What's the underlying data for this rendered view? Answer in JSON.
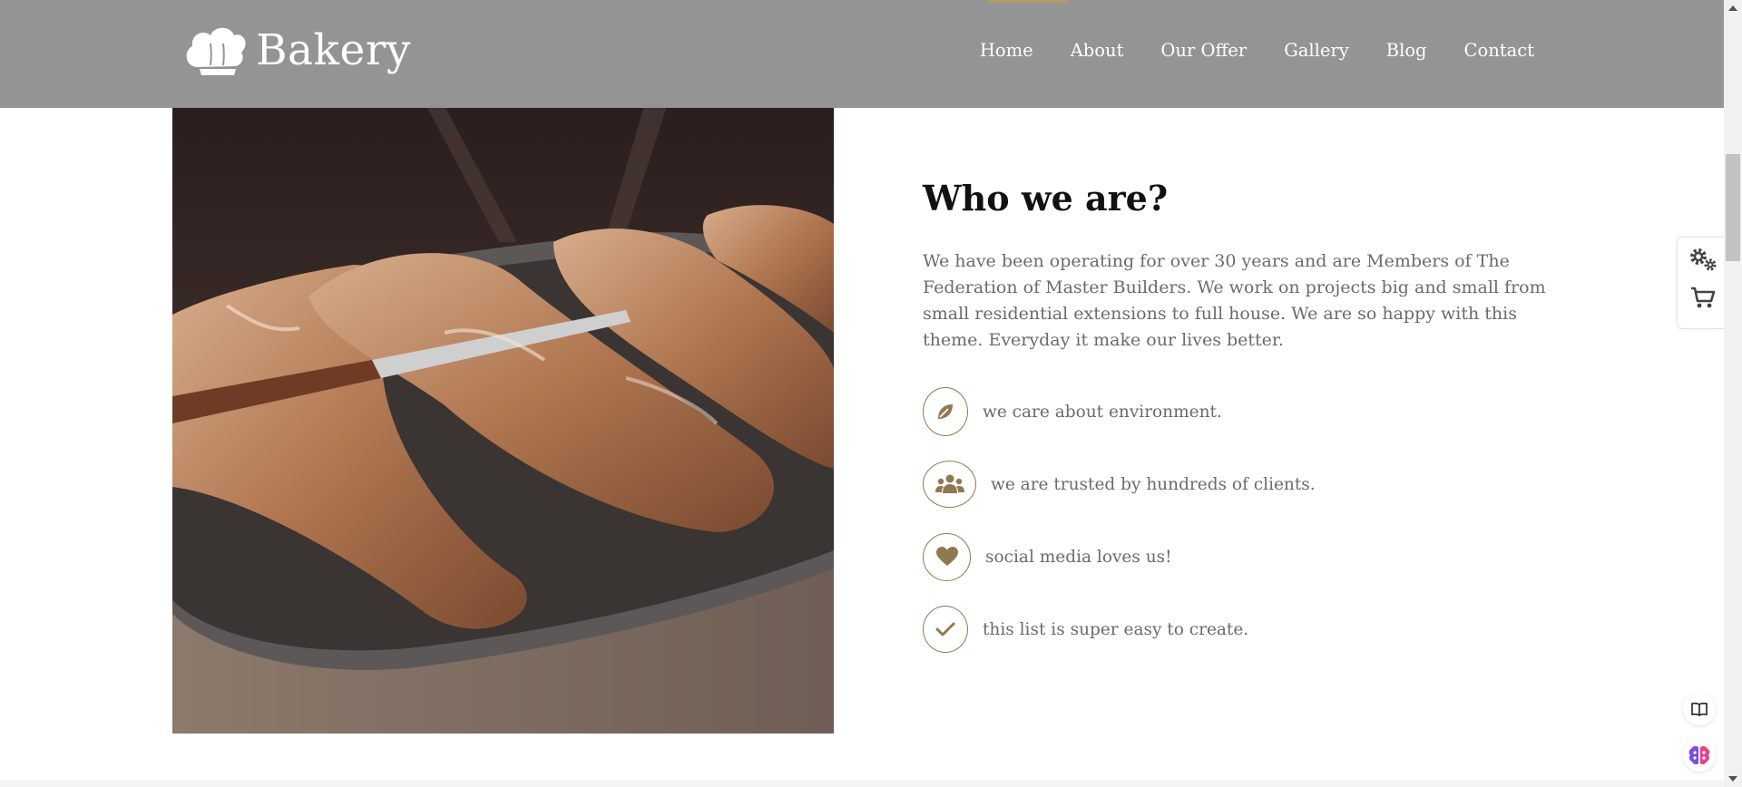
{
  "header": {
    "brand": "Bakery",
    "nav": [
      "Home",
      "About",
      "Our Offer",
      "Gallery",
      "Blog",
      "Contact"
    ]
  },
  "about": {
    "title": "Who we are?",
    "description": "We have been operating for over 30 years and are Members of The Federation of Master Builders. We work on projects big and small from small residential extensions to full house. We are so happy with this theme. Everyday it make our lives better.",
    "features": [
      {
        "icon": "leaf-icon",
        "text": "we care about environment."
      },
      {
        "icon": "users-icon",
        "text": "we are trusted by hundreds of clients."
      },
      {
        "icon": "heart-icon",
        "text": "social media loves us!"
      },
      {
        "icon": "check-icon",
        "text": "this list is super easy to create."
      }
    ]
  },
  "colors": {
    "header_bg": "#949494",
    "accent": "#8f7a50",
    "active_marker": "#b59a66",
    "text_body": "#6b6b6b",
    "heading": "#111111"
  },
  "side_tools": [
    "settings-cogs-icon",
    "cart-icon",
    "book-icon",
    "brain-icon"
  ]
}
